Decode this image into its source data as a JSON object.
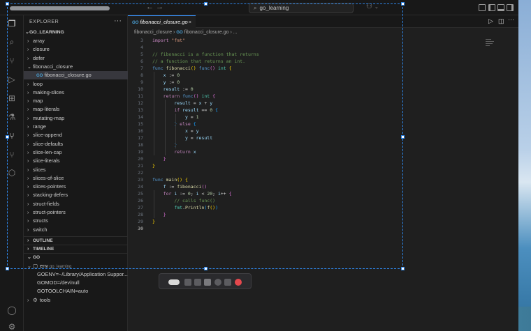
{
  "window": {
    "search_text": "go_learning"
  },
  "sidebar": {
    "title": "EXPLORER",
    "root": "GO_LEARNING",
    "items": [
      {
        "label": "array",
        "chev": "›",
        "indent": 1
      },
      {
        "label": "closure",
        "chev": "›",
        "indent": 1
      },
      {
        "label": "defer",
        "chev": "›",
        "indent": 1
      },
      {
        "label": "fibonacci_closure",
        "chev": "⌄",
        "indent": 1
      },
      {
        "label": "fibonacci_closure.go",
        "chev": "",
        "indent": 2,
        "file": true,
        "selected": true
      },
      {
        "label": "loop",
        "chev": "›",
        "indent": 1
      },
      {
        "label": "making-slices",
        "chev": "›",
        "indent": 1
      },
      {
        "label": "map",
        "chev": "›",
        "indent": 1
      },
      {
        "label": "map-literals",
        "chev": "›",
        "indent": 1
      },
      {
        "label": "mutating-map",
        "chev": "›",
        "indent": 1
      },
      {
        "label": "range",
        "chev": "›",
        "indent": 1
      },
      {
        "label": "slice-append",
        "chev": "›",
        "indent": 1
      },
      {
        "label": "slice-defaults",
        "chev": "›",
        "indent": 1
      },
      {
        "label": "slice-len-cap",
        "chev": "›",
        "indent": 1
      },
      {
        "label": "slice-literals",
        "chev": "›",
        "indent": 1
      },
      {
        "label": "slices",
        "chev": "›",
        "indent": 1
      },
      {
        "label": "slices-of-slice",
        "chev": "›",
        "indent": 1
      },
      {
        "label": "slices-pointers",
        "chev": "›",
        "indent": 1
      },
      {
        "label": "stacking-defers",
        "chev": "›",
        "indent": 1
      },
      {
        "label": "struct-fields",
        "chev": "›",
        "indent": 1
      },
      {
        "label": "struct-pointers",
        "chev": "›",
        "indent": 1
      },
      {
        "label": "structs",
        "chev": "›",
        "indent": 1
      },
      {
        "label": "switch",
        "chev": "›",
        "indent": 1
      }
    ],
    "sections": {
      "outline": "OUTLINE",
      "timeline": "TIMELINE",
      "go": "GO"
    },
    "go_env": {
      "env_label": "env",
      "env_sub": "go_learning",
      "goenv": "GOENV=~/Library/Application Suppor...",
      "gomod": "GOMOD=/dev/null",
      "gotoolchain": "GOTOOLCHAIN=auto",
      "tools": "tools"
    }
  },
  "editor": {
    "tab_label": "fibonacci_closure.go",
    "breadcrumb_folder": "fibonacci_closure",
    "breadcrumb_sep": "›",
    "breadcrumb_file": "fibonacci_closure.go",
    "breadcrumb_tail": "› ...",
    "current_line": 30,
    "lines": [
      {
        "n": 3,
        "t": [
          [
            "kw",
            "import "
          ],
          [
            "str",
            "\"fmt\""
          ]
        ]
      },
      {
        "n": 4,
        "t": []
      },
      {
        "n": 5,
        "t": [
          [
            "cm",
            "// fibonacci is a function that returns"
          ]
        ]
      },
      {
        "n": 6,
        "t": [
          [
            "cm",
            "// a function that returns an int."
          ]
        ]
      },
      {
        "n": 7,
        "t": [
          [
            "kwb",
            "func "
          ],
          [
            "fn",
            "fibonacci"
          ],
          [
            "br1",
            "()"
          ],
          [
            "op",
            " "
          ],
          [
            "kwb",
            "func"
          ],
          [
            "br2",
            "()"
          ],
          [
            "op",
            " "
          ],
          [
            "ty",
            "int"
          ],
          [
            "op",
            " "
          ],
          [
            "br1",
            "{"
          ]
        ]
      },
      {
        "n": 8,
        "t": [
          [
            "op",
            "    "
          ],
          [
            "id",
            "x"
          ],
          [
            "op",
            " := "
          ],
          [
            "num",
            "0"
          ]
        ]
      },
      {
        "n": 9,
        "t": [
          [
            "op",
            "    "
          ],
          [
            "id",
            "y"
          ],
          [
            "op",
            " := "
          ],
          [
            "num",
            "0"
          ]
        ]
      },
      {
        "n": 10,
        "t": [
          [
            "op",
            "    "
          ],
          [
            "id",
            "result"
          ],
          [
            "op",
            " := "
          ],
          [
            "num",
            "0"
          ]
        ]
      },
      {
        "n": 11,
        "t": [
          [
            "op",
            "    "
          ],
          [
            "kw",
            "return "
          ],
          [
            "kwb",
            "func"
          ],
          [
            "br2",
            "()"
          ],
          [
            "op",
            " "
          ],
          [
            "ty",
            "int"
          ],
          [
            "op",
            " "
          ],
          [
            "br2",
            "{"
          ]
        ]
      },
      {
        "n": 12,
        "t": [
          [
            "op",
            "        "
          ],
          [
            "id",
            "result"
          ],
          [
            "op",
            " = "
          ],
          [
            "id",
            "x"
          ],
          [
            "op",
            " + "
          ],
          [
            "id",
            "y"
          ]
        ]
      },
      {
        "n": 13,
        "t": [
          [
            "op",
            "        "
          ],
          [
            "kw",
            "if "
          ],
          [
            "id",
            "result"
          ],
          [
            "op",
            " == "
          ],
          [
            "num",
            "0"
          ],
          [
            "op",
            " "
          ],
          [
            "br3",
            "{"
          ]
        ]
      },
      {
        "n": 14,
        "t": [
          [
            "op",
            "            "
          ],
          [
            "id",
            "y"
          ],
          [
            "op",
            " = "
          ],
          [
            "num",
            "1"
          ]
        ]
      },
      {
        "n": 15,
        "t": [
          [
            "op",
            "        "
          ],
          [
            "br3",
            "}"
          ],
          [
            "op",
            " "
          ],
          [
            "kw",
            "else"
          ],
          [
            "op",
            " "
          ],
          [
            "br3",
            "{"
          ]
        ]
      },
      {
        "n": 16,
        "t": [
          [
            "op",
            "            "
          ],
          [
            "id",
            "x"
          ],
          [
            "op",
            " = "
          ],
          [
            "id",
            "y"
          ]
        ]
      },
      {
        "n": 17,
        "t": [
          [
            "op",
            "            "
          ],
          [
            "id",
            "y"
          ],
          [
            "op",
            " = "
          ],
          [
            "id",
            "result"
          ]
        ]
      },
      {
        "n": 18,
        "t": [
          [
            "op",
            "        "
          ],
          [
            "br3",
            "}"
          ]
        ]
      },
      {
        "n": 19,
        "t": [
          [
            "op",
            "        "
          ],
          [
            "kw",
            "return "
          ],
          [
            "id",
            "x"
          ]
        ]
      },
      {
        "n": 20,
        "t": [
          [
            "op",
            "    "
          ],
          [
            "br2",
            "}"
          ]
        ]
      },
      {
        "n": 21,
        "t": [
          [
            "br1",
            "}"
          ]
        ]
      },
      {
        "n": 22,
        "t": []
      },
      {
        "n": 23,
        "t": [
          [
            "kwb",
            "func "
          ],
          [
            "fn",
            "main"
          ],
          [
            "br1",
            "()"
          ],
          [
            "op",
            " "
          ],
          [
            "br1",
            "{"
          ]
        ]
      },
      {
        "n": 24,
        "t": [
          [
            "op",
            "    "
          ],
          [
            "id",
            "f"
          ],
          [
            "op",
            " := "
          ],
          [
            "fn",
            "fibonacci"
          ],
          [
            "br2",
            "()"
          ]
        ]
      },
      {
        "n": 25,
        "t": [
          [
            "op",
            "    "
          ],
          [
            "kw",
            "for "
          ],
          [
            "id",
            "i"
          ],
          [
            "op",
            " := "
          ],
          [
            "num",
            "0"
          ],
          [
            "op",
            "; "
          ],
          [
            "id",
            "i"
          ],
          [
            "op",
            " < "
          ],
          [
            "num",
            "20"
          ],
          [
            "op",
            "; "
          ],
          [
            "id",
            "i"
          ],
          [
            "op",
            "++ "
          ],
          [
            "br2",
            "{"
          ]
        ]
      },
      {
        "n": 26,
        "t": [
          [
            "op",
            "        "
          ],
          [
            "cm",
            "// calls func()"
          ]
        ]
      },
      {
        "n": 27,
        "t": [
          [
            "op",
            "        "
          ],
          [
            "ty",
            "fmt"
          ],
          [
            "op",
            "."
          ],
          [
            "fn",
            "Println"
          ],
          [
            "br3",
            "("
          ],
          [
            "fn",
            "f"
          ],
          [
            "br1",
            "()"
          ],
          [
            "br3",
            ")"
          ]
        ]
      },
      {
        "n": 28,
        "t": [
          [
            "op",
            "    "
          ],
          [
            "br2",
            "}"
          ]
        ]
      },
      {
        "n": 29,
        "t": [
          [
            "br1",
            "}"
          ]
        ]
      },
      {
        "n": 30,
        "t": []
      }
    ]
  },
  "colors": {
    "accent": "#3794ff",
    "selection_dash": "#2f86e8",
    "record": "#e5484d"
  }
}
